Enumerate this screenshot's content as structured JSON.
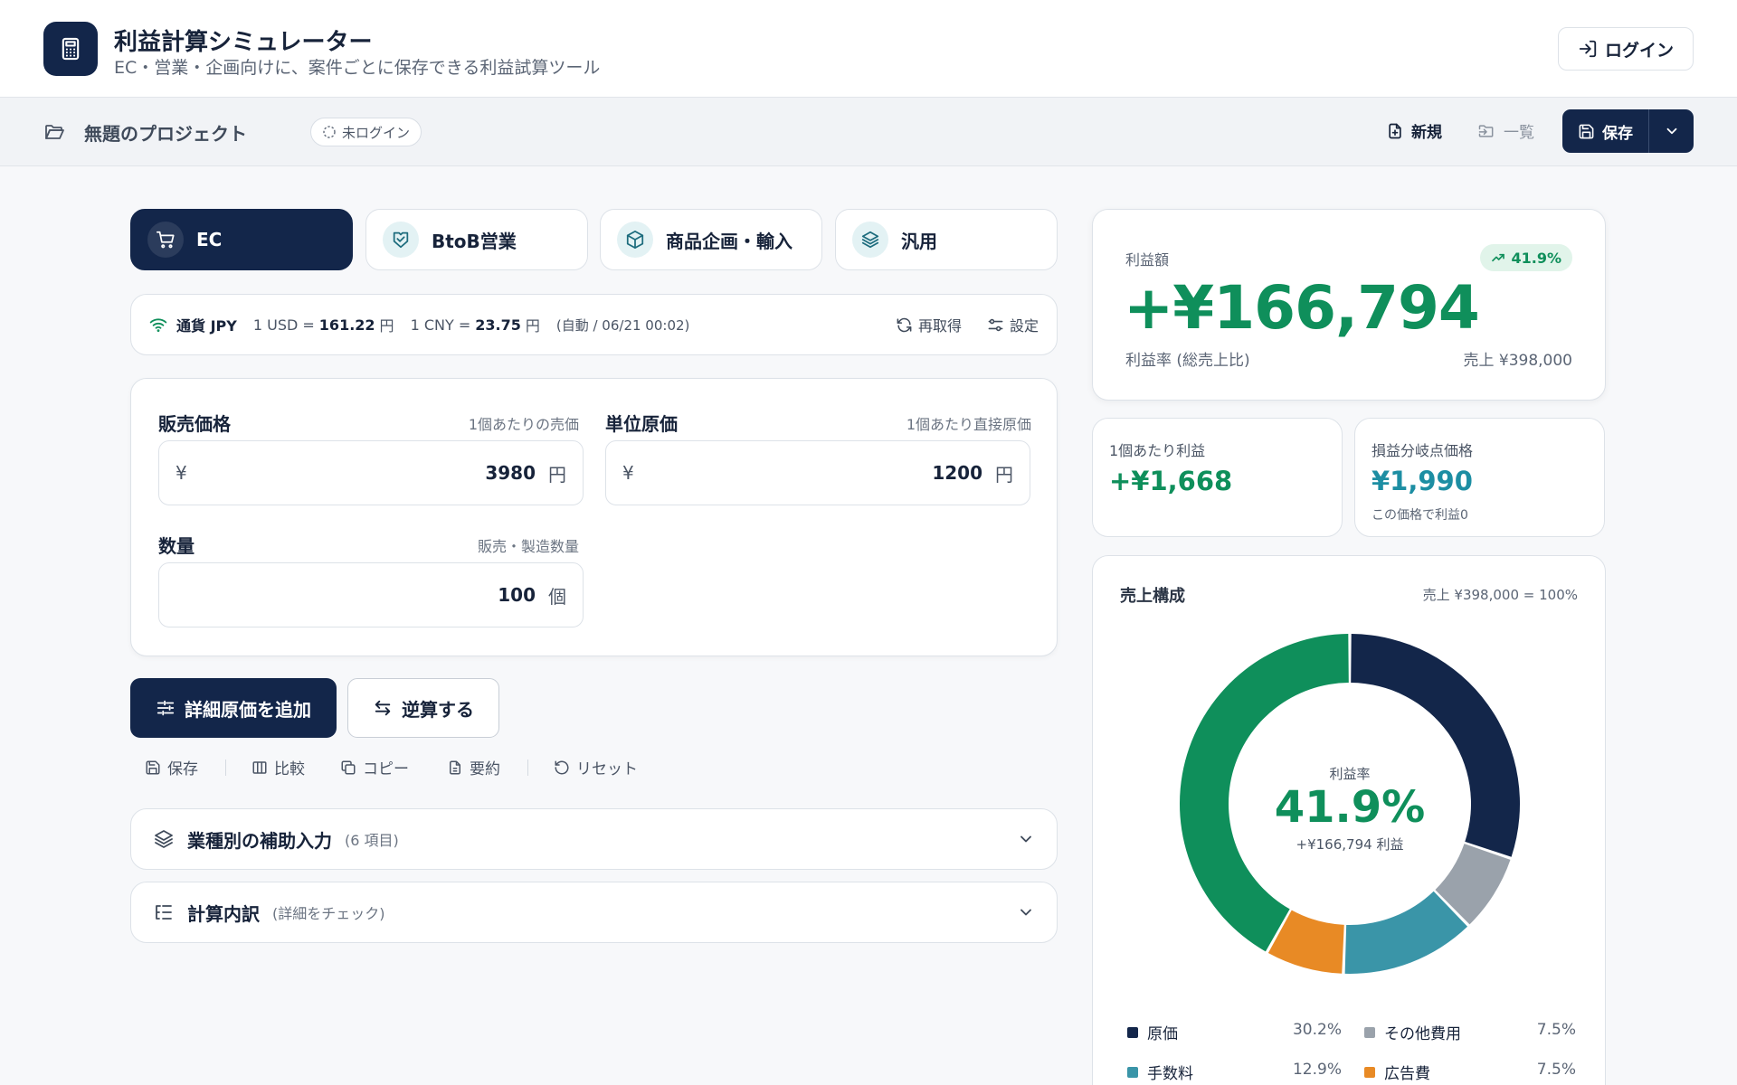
{
  "app": {
    "title": "利益計算シミュレーター",
    "subtitle": "EC・営業・企画向けに、案件ごとに保存できる利益試算ツール",
    "login_label": "ログイン"
  },
  "project_bar": {
    "project_name": "無題のプロジェクト",
    "login_status": "未ログイン",
    "new_label": "新規",
    "list_label": "一覧",
    "save_label": "保存"
  },
  "tabs": [
    {
      "label": "EC",
      "icon": "cart-icon",
      "active": true
    },
    {
      "label": "BtoB営業",
      "icon": "handshake-icon",
      "active": false
    },
    {
      "label": "商品企画・輸入",
      "icon": "box-icon",
      "active": false
    },
    {
      "label": "汎用",
      "icon": "layers-icon",
      "active": false
    }
  ],
  "currency": {
    "currency_label": "通貨 JPY",
    "usd_prefix": "1 USD =",
    "usd_rate": "161.22",
    "usd_unit": "円",
    "cny_prefix": "1 CNY =",
    "cny_rate": "23.75",
    "cny_unit": "円",
    "updated": "(自動 / 06/21 00:02)",
    "refresh_label": "再取得",
    "settings_label": "設定"
  },
  "inputs": {
    "price": {
      "label": "販売価格",
      "hint": "1個あたりの売価",
      "prefix": "¥",
      "value": "3980",
      "unit": "円"
    },
    "cost": {
      "label": "単位原価",
      "hint": "1個あたり直接原価",
      "prefix": "¥",
      "value": "1200",
      "unit": "円"
    },
    "quantity": {
      "label": "数量",
      "hint": "販売・製造数量",
      "value": "100",
      "unit": "個"
    }
  },
  "actions": {
    "add_cost_label": "詳細原価を追加",
    "reverse_label": "逆算する",
    "tools": [
      "保存",
      "比較",
      "コピー",
      "要約",
      "リセット"
    ]
  },
  "accordions": [
    {
      "title": "業種別の補助入力",
      "sub": "(6 項目)"
    },
    {
      "title": "計算内訳",
      "sub": "(詳細をチェック)"
    }
  ],
  "summary": {
    "profit_label": "利益額",
    "profit_badge": "41.9%",
    "profit_amount": "+¥166,794",
    "profit_rate_label": "利益率 (総売上比)",
    "sales_label": "売上 ¥398,000",
    "unit_profit_label": "1個あたり利益",
    "unit_profit_value": "+¥1,668",
    "breakeven_label": "損益分岐点価格",
    "breakeven_value": "¥1,990",
    "breakeven_note": "この価格で利益0"
  },
  "composition": {
    "title": "売上構成",
    "total_label": "売上 ¥398,000 = 100%",
    "center_label": "利益率",
    "center_value": "41.9%",
    "center_sub": "+¥166,794 利益",
    "colors": {
      "cost": "#13264a",
      "other": "#9aa2ab",
      "fee": "#3a95a8",
      "ad": "#e88a25",
      "profit": "#0f8f5b"
    }
  },
  "chart_data": {
    "type": "pie",
    "title": "売上構成",
    "categories": [
      "原価",
      "その他費用",
      "手数料",
      "広告費",
      "利益"
    ],
    "values": [
      30.2,
      7.5,
      12.9,
      7.5,
      41.9
    ],
    "value_labels": [
      "30.2%",
      "7.5%",
      "12.9%",
      "7.5%",
      ""
    ],
    "colors": [
      "#13264a",
      "#9aa2ab",
      "#3a95a8",
      "#e88a25",
      "#0f8f5b"
    ]
  }
}
